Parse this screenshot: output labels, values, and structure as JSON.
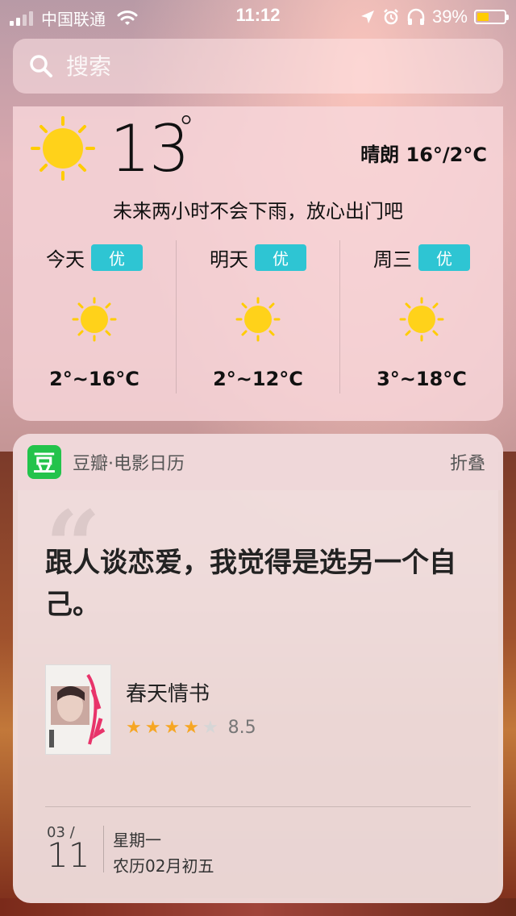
{
  "status_bar": {
    "carrier": "中国联通",
    "time": "11:12",
    "battery": "39%",
    "battery_level": 0.39
  },
  "search": {
    "placeholder": "搜索"
  },
  "weather": {
    "temperature": "13",
    "degree_symbol": "°",
    "condition": "晴朗 16°/2°C",
    "tip": "未来两小时不会下雨，放心出门吧",
    "forecast": [
      {
        "day": "今天",
        "aqi": "优",
        "range": "2°~16°C",
        "icon": "sun-icon"
      },
      {
        "day": "明天",
        "aqi": "优",
        "range": "2°~12°C",
        "icon": "sun-icon"
      },
      {
        "day": "周三",
        "aqi": "优",
        "range": "3°~18°C",
        "icon": "sun-icon"
      }
    ]
  },
  "douban": {
    "logo": "豆",
    "title": "豆瓣·电影日历",
    "fold_label": "折叠",
    "quote": "跟人谈恋爱，我觉得是选另一个自己。",
    "movie_title": "春天情书",
    "rating_stars": 4,
    "rating_max": 5,
    "score": "8.5",
    "date_month": "03 /",
    "date_day": "11",
    "weekday": "星期一",
    "lunar": "农历02月初五"
  }
}
